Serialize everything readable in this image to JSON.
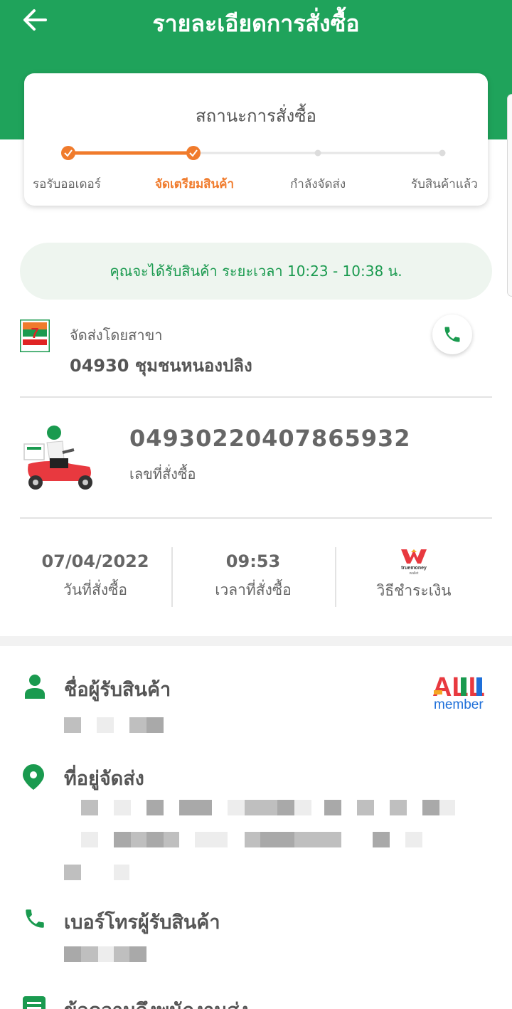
{
  "header": {
    "title": "รายละเอียดการสั่งซื้อ",
    "back_icon": "arrow-left-icon",
    "color": "#1fa35b"
  },
  "status": {
    "title": "สถานะการสั่งซื้อ",
    "steps": [
      {
        "label": "รอรับออเดอร์",
        "state": "done"
      },
      {
        "label": "จัดเตรียมสินค้า",
        "state": "current"
      },
      {
        "label": "กำลังจัดส่ง",
        "state": "pending"
      },
      {
        "label": "รับสินค้าแล้ว",
        "state": "pending"
      }
    ],
    "progress_steps_completed": 2,
    "accent_color": "#f07b2c"
  },
  "eta": {
    "text": "คุณจะได้รับสินค้า ระยะเวลา 10:23 - 10:38 น."
  },
  "branch": {
    "label": "จัดส่งโดยสาขา",
    "name": "04930 ชุมชนหนองปลิง",
    "logo": "7-eleven-logo",
    "call_icon": "phone-icon"
  },
  "order": {
    "number": "04930220407865932",
    "number_label": "เลขที่สั่งซื้อ",
    "illustration": "delivery-scooter-icon"
  },
  "info": {
    "date": "07/04/2022",
    "date_label": "วันที่สั่งซื้อ",
    "time": "09:53",
    "time_label": "เวลาที่สั่งซื้อ",
    "payment_label": "วิธีชำระเงิน",
    "payment_logo": "truemoney-wallet-logo",
    "payment_logo_text": "truemoney",
    "payment_logo_subtext": "wallet"
  },
  "recipient": {
    "name_title": "ชื่อผู้รับสินค้า",
    "address_title": "ที่อยู่จัดส่ง",
    "phone_title": "เบอร์โทรผู้รับสินค้า",
    "note_title": "ข้อความถึงพนักงานส่ง",
    "member_logo_text": "ALL",
    "member_logo_subtext": "member"
  }
}
